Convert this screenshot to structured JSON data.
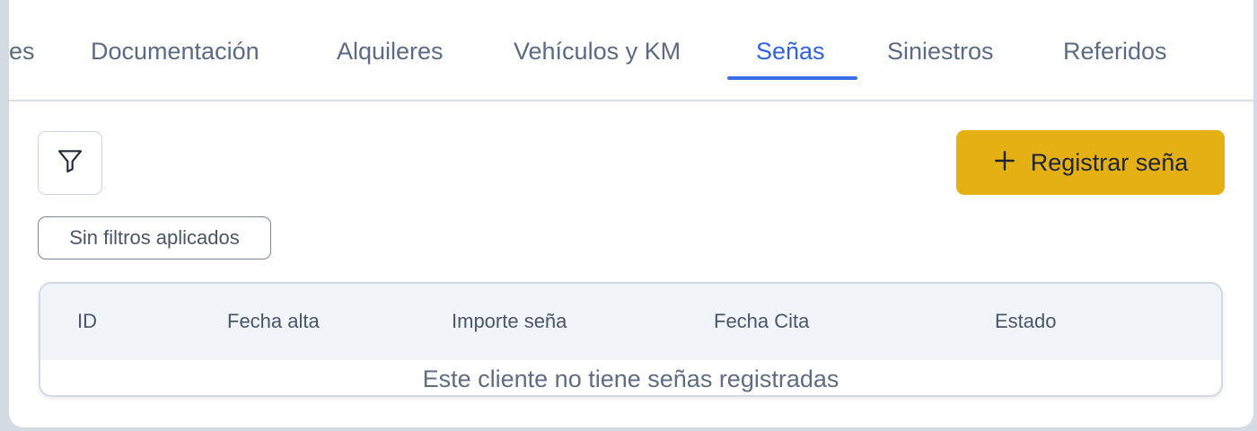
{
  "tabs": [
    {
      "label": "es",
      "active": false
    },
    {
      "label": "Documentación",
      "active": false
    },
    {
      "label": "Alquileres",
      "active": false
    },
    {
      "label": "Vehículos y KM",
      "active": false
    },
    {
      "label": "Señas",
      "active": true
    },
    {
      "label": "Siniestros",
      "active": false
    },
    {
      "label": "Referidos",
      "active": false
    }
  ],
  "toolbar": {
    "filter_icon": "filter-icon",
    "register_label": "Registrar seña",
    "register_icon": "plus-icon"
  },
  "filters": {
    "chip_label": "Sin filtros aplicados"
  },
  "table": {
    "columns": [
      "ID",
      "Fecha alta",
      "Importe seña",
      "Fecha Cita",
      "Estado"
    ],
    "rows": [],
    "empty_message": "Este cliente no tiene señas registradas"
  },
  "colors": {
    "accent": "#3b6ee6",
    "primary_button": "#e5b013"
  }
}
